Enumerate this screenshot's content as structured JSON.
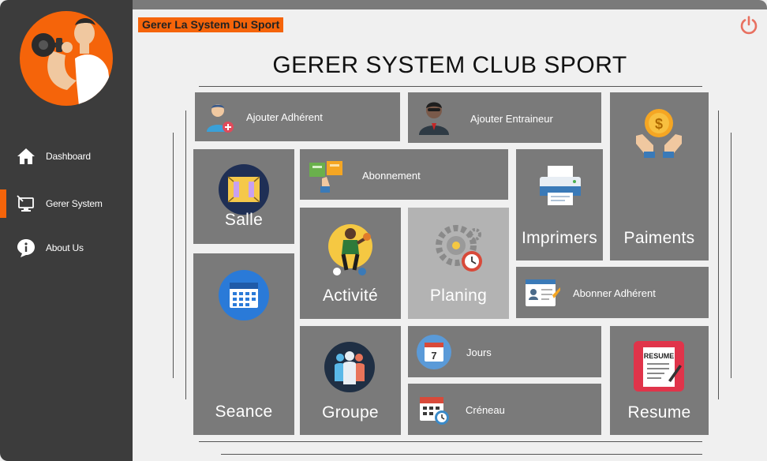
{
  "app": {
    "badge": "Gerer La System Du Sport"
  },
  "page": {
    "title": "GERER SYSTEM CLUB SPORT"
  },
  "sidebar": {
    "items": [
      {
        "label": "Dashboard",
        "icon": "home-icon",
        "active": false
      },
      {
        "label": "Gerer System",
        "icon": "monitor-icon",
        "active": true
      },
      {
        "label": "About Us",
        "icon": "info-icon",
        "active": false
      }
    ]
  },
  "tiles": {
    "ajouter_adherent": {
      "label": "Ajouter Adhérent",
      "icon": "add-user-icon"
    },
    "ajouter_entraineur": {
      "label": "Ajouter Entraineur",
      "icon": "trainer-icon"
    },
    "paiments": {
      "label": "Paiments",
      "icon": "money-hands-icon"
    },
    "salle": {
      "label": "Salle",
      "icon": "room-icon"
    },
    "abonnement": {
      "label": "Abonnement",
      "icon": "tickets-icon"
    },
    "imprimers": {
      "label": "Imprimers",
      "icon": "printer-icon"
    },
    "activite": {
      "label": "Activité",
      "icon": "athlete-icon"
    },
    "planing": {
      "label": "Planing",
      "icon": "gears-clock-icon"
    },
    "abonner_adherent": {
      "label": "Abonner Adhérent",
      "icon": "id-card-icon"
    },
    "seance": {
      "label": "Seance",
      "icon": "calendar-icon"
    },
    "groupe": {
      "label": "Groupe",
      "icon": "group-icon"
    },
    "jours": {
      "label": "Jours",
      "icon": "calendar-day-icon",
      "day_number": "7"
    },
    "creneau": {
      "label": "Créneau",
      "icon": "calendar-clock-icon"
    },
    "resume": {
      "label": "Resume",
      "icon": "resume-icon",
      "icon_text": "RESUME"
    }
  },
  "colors": {
    "accent": "#f5640a",
    "sidebar_bg": "#3c3c3c",
    "tile_bg": "#7a7a7a",
    "tile_light_bg": "#b3b3b3",
    "page_bg": "#f0f0f0",
    "power": "#e87060"
  }
}
